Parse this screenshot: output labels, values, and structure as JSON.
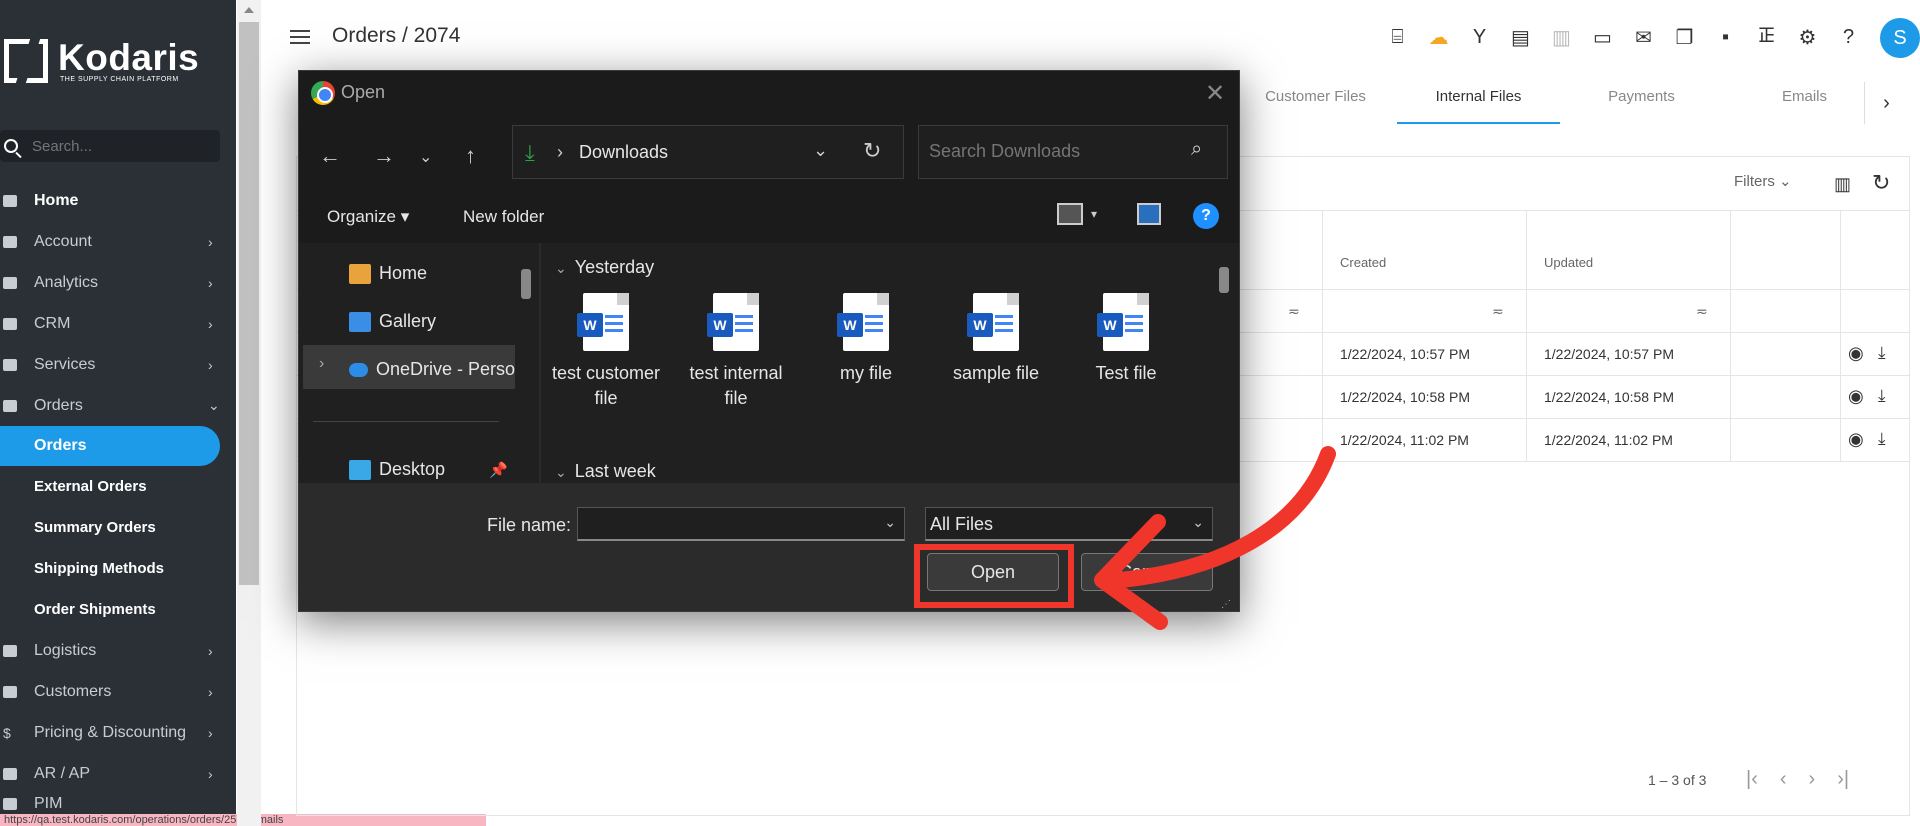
{
  "sidebar": {
    "logo_name": "Kodaris",
    "logo_tagline": "THE SUPPLY CHAIN PLATFORM",
    "search_placeholder": "Search...",
    "items": [
      {
        "label": "Home"
      },
      {
        "label": "Account"
      },
      {
        "label": "Analytics"
      },
      {
        "label": "CRM"
      },
      {
        "label": "Services"
      },
      {
        "label": "Orders"
      }
    ],
    "orders_sub": [
      "Orders",
      "External Orders",
      "Summary Orders",
      "Shipping Methods",
      "Order Shipments"
    ],
    "items_after": [
      {
        "label": "Logistics"
      },
      {
        "label": "Customers"
      },
      {
        "label": "Pricing & Discounting"
      },
      {
        "label": "AR / AP"
      },
      {
        "label": "PIM"
      }
    ],
    "status_url": "https://qa.test.kodaris.com/operations/orders/2574/emails"
  },
  "header": {
    "breadcrumb": "Orders / 2074",
    "avatar_letter": "S",
    "icons": [
      "gift-icon",
      "cloud-upload-icon",
      "merge-icon",
      "archive-icon",
      "receipt-icon",
      "card-icon",
      "mail-icon",
      "copy-icon",
      "file-add-icon",
      "paperclip-icon",
      "gear-icon",
      "help-icon"
    ]
  },
  "tabs": {
    "items": [
      "Customer Files",
      "Internal Files",
      "Payments",
      "Emails"
    ],
    "active": "Internal Files"
  },
  "table": {
    "filters_label": "Filters",
    "headers": [
      "Created",
      "Updated"
    ],
    "rows": [
      {
        "created": "1/22/2024, 10:57 PM",
        "updated": "1/22/2024, 10:57 PM"
      },
      {
        "created": "1/22/2024, 10:58 PM",
        "updated": "1/22/2024, 10:58 PM"
      },
      {
        "created": "1/22/2024, 11:02 PM",
        "updated": "1/22/2024, 11:02 PM"
      }
    ],
    "pager_text": "1 – 3 of 3"
  },
  "dialog": {
    "title": "Open",
    "location": "Downloads",
    "search_placeholder": "Search Downloads",
    "organize_label": "Organize",
    "new_folder_label": "New folder",
    "nav_items": {
      "home": "Home",
      "gallery": "Gallery",
      "onedrive": "OneDrive - Perso",
      "desktop": "Desktop"
    },
    "group_yesterday": "Yesterday",
    "group_last_week": "Last week",
    "files": [
      "test customer file",
      "test internal file",
      "my file",
      "sample file",
      "Test file"
    ],
    "file_name_label": "File name:",
    "file_name_value": "",
    "file_type": "All Files",
    "open_label": "Open",
    "cancel_label": "Cancel"
  },
  "colors": {
    "accent": "#1e9be8",
    "sidebar_bg": "#2b3037",
    "highlight": "#f0352b"
  }
}
